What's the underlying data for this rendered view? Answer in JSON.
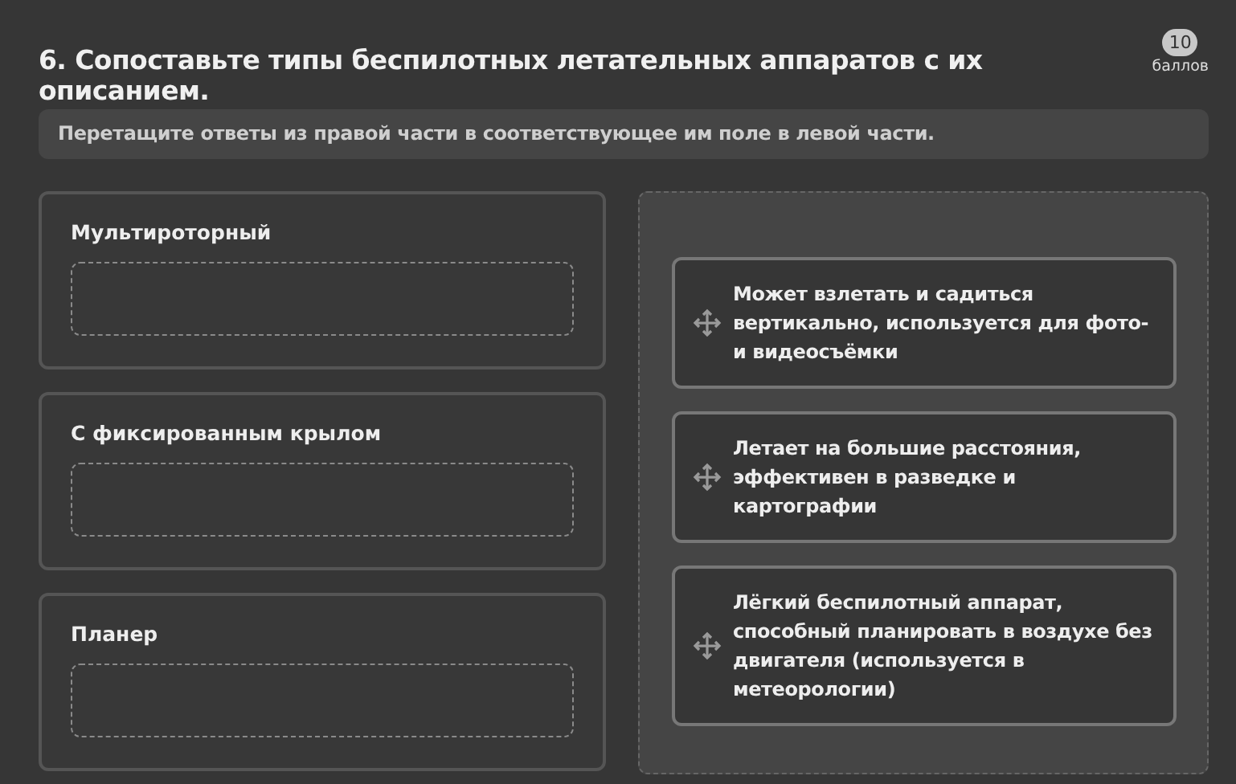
{
  "question": {
    "title": "6. Сопоставьте типы беспилотных летательных аппаратов с их описанием.",
    "points": "10",
    "points_label": "баллов"
  },
  "instruction": "Перетащите ответы из правой части в соответствующее им поле в левой части.",
  "targets": [
    {
      "label": "Мультироторный"
    },
    {
      "label": "С фиксированным крылом"
    },
    {
      "label": "Планер"
    }
  ],
  "answers": [
    {
      "text": "Может взлетать и садиться вертикально, используется для фото- и видеосъёмки"
    },
    {
      "text": "Летает на большие расстояния, эффективен в разведке и картографии"
    },
    {
      "text": "Лёгкий беспилотный аппарат, способный планировать в воздухе без двигателя (используется в метеорологии)"
    }
  ]
}
